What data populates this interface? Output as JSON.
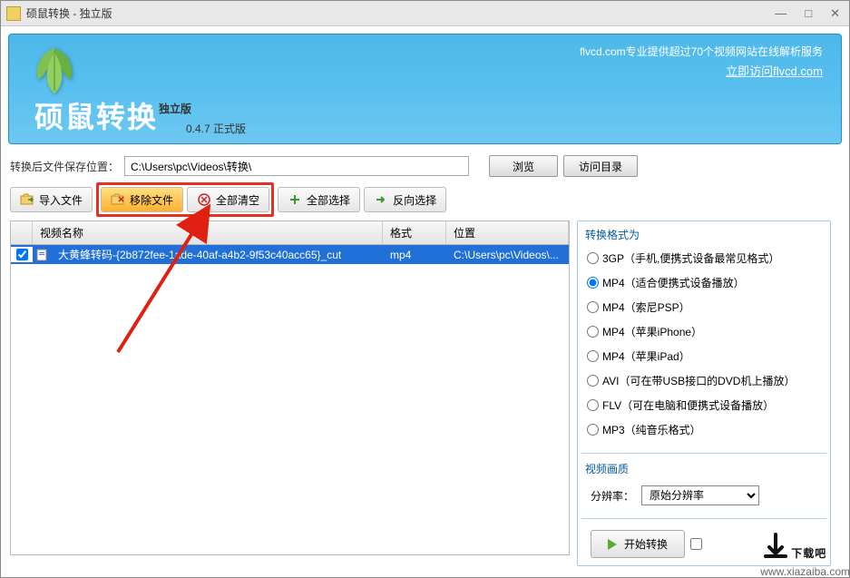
{
  "window": {
    "title": "硕鼠转换 - 独立版"
  },
  "banner": {
    "promo": "flvcd.com专业提供超过70个视频网站在线解析服务",
    "visit_link": "立即访问flvcd.com",
    "app_name": "硕鼠转换",
    "tag_dulan": "独立版",
    "tag_version": "0.4.7  正式版"
  },
  "path_row": {
    "label": "转换后文件保存位置：",
    "value": "C:\\Users\\pc\\Videos\\转换\\",
    "browse": "浏览",
    "open_dir": "访问目录"
  },
  "toolbar": {
    "import": "导入文件",
    "remove": "移除文件",
    "clear": "全部清空",
    "select_all": "全部选择",
    "invert": "反向选择"
  },
  "table": {
    "headers": {
      "name": "视频名称",
      "format": "格式",
      "location": "位置"
    },
    "rows": [
      {
        "checked": true,
        "name": "大黄蜂转码-{2b872fee-1ade-40af-a4b2-9f53c40acc65}_cut",
        "format": "mp4",
        "location": "C:\\Users\\pc\\Videos\\..."
      }
    ]
  },
  "formats": {
    "title": "转换格式为",
    "options": [
      {
        "id": "3gp",
        "label": "3GP（手机,便携式设备最常见格式）",
        "selected": false
      },
      {
        "id": "mp4",
        "label": "MP4（适合便携式设备播放）",
        "selected": true
      },
      {
        "id": "mp4psp",
        "label": "MP4（索尼PSP）",
        "selected": false
      },
      {
        "id": "mp4iphone",
        "label": "MP4（苹果iPhone）",
        "selected": false
      },
      {
        "id": "mp4ipad",
        "label": "MP4（苹果iPad）",
        "selected": false
      },
      {
        "id": "avi",
        "label": "AVI（可在带USB接口的DVD机上播放）",
        "selected": false
      },
      {
        "id": "flv",
        "label": "FLV（可在电脑和便携式设备播放）",
        "selected": false
      },
      {
        "id": "mp3",
        "label": "MP3（纯音乐格式）",
        "selected": false
      }
    ]
  },
  "quality": {
    "title": "视频画质",
    "resolution_label": "分辨率：",
    "resolution_value": "原始分辨率"
  },
  "actions": {
    "start": "开始转换"
  },
  "watermark": {
    "text": "下载吧",
    "url": "www.xiazaiba.com"
  }
}
